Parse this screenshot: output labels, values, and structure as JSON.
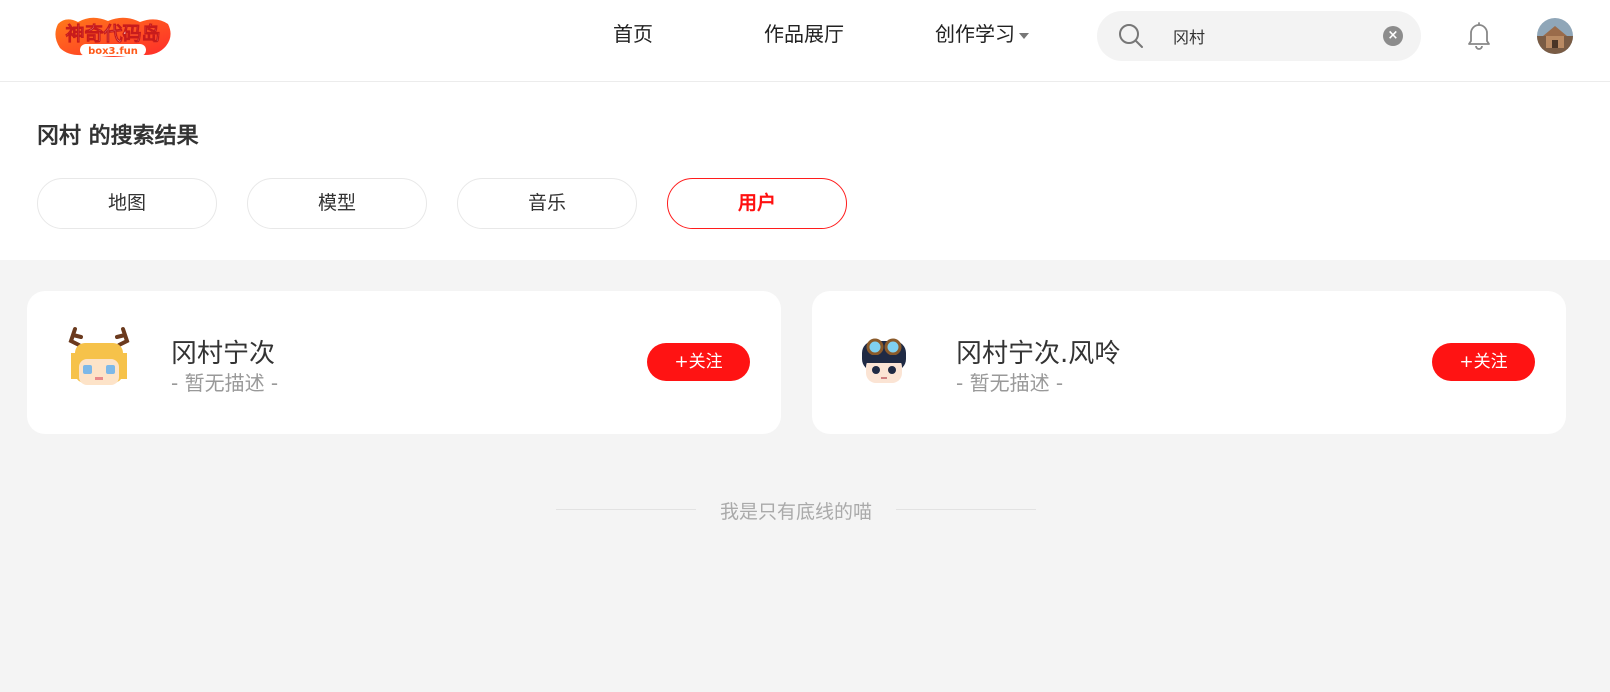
{
  "header": {
    "logo_text": "神奇代码岛",
    "logo_sub": "box3.fun",
    "nav": [
      {
        "label": "首页"
      },
      {
        "label": "作品展厅"
      },
      {
        "label": "创作学习"
      }
    ],
    "search": {
      "value": "冈村",
      "placeholder": ""
    },
    "icons": {
      "search": "search-icon",
      "clear": "clear-icon",
      "notification": "bell-icon",
      "avatar": "user-avatar"
    }
  },
  "results": {
    "title": "冈村 的搜索结果",
    "tabs": [
      {
        "label": "地图",
        "active": false
      },
      {
        "label": "模型",
        "active": false
      },
      {
        "label": "音乐",
        "active": false
      },
      {
        "label": "用户",
        "active": true
      }
    ]
  },
  "users": [
    {
      "name": "冈村宁次",
      "description": "- 暂无描述 -",
      "follow_label": "+关注"
    },
    {
      "name": "冈村宁次.风呤",
      "description": "- 暂无描述 -",
      "follow_label": "+关注"
    }
  ],
  "footer": {
    "end_text": "我是只有底线的喵"
  },
  "colors": {
    "accent": "#ff1313",
    "page_bg": "#f4f4f4",
    "card_bg": "#ffffff"
  }
}
